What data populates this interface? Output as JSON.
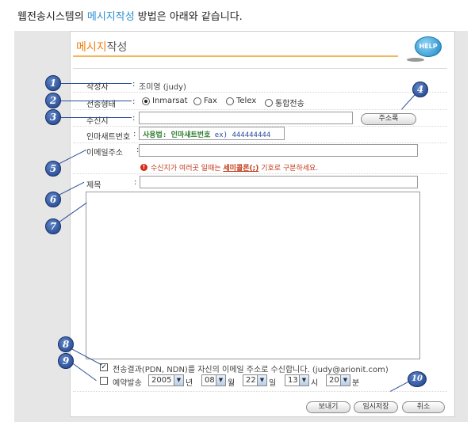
{
  "heading": {
    "prefix": "웹전송시스템의 ",
    "highlight": "메시지작성",
    "suffix": " 방법은 아래와 같습니다."
  },
  "window": {
    "title_accent": "메시지",
    "title_rest": "작성",
    "help_label": "HELP"
  },
  "form": {
    "author_label": "작성자",
    "author_value": "조미영 (judy)",
    "send_type_label": "전송형태",
    "send_types": [
      {
        "label": "Inmarsat",
        "selected": true
      },
      {
        "label": "Fax",
        "selected": false
      },
      {
        "label": "Telex",
        "selected": false
      },
      {
        "label": "통합전송",
        "selected": false
      }
    ],
    "recipient_label": "수신지",
    "recipient_value": "",
    "address_book_label": "주소록",
    "inmarsat_label": "인마새트번호",
    "inmarsat_usage": "사용법: 인마새트번호",
    "inmarsat_example": "ex) 444444444",
    "email_label": "이메일주소",
    "email_value": "",
    "warning": {
      "icon": "!",
      "before": "수신지가 여러곳 일때는 ",
      "emph": "세미콜론(;)",
      "after": " 기호로 구분하세요."
    },
    "subject_label": "제목",
    "subject_value": "",
    "body_value": "",
    "receive_result": {
      "checked": true,
      "label": "전송결과(PDN, NDN)를 자신의 이메일 주소로 수신합니다. (judy@arionit.com)"
    },
    "reserve": {
      "checked": false,
      "label": "예약발송",
      "year": "2005",
      "year_unit": "년",
      "month": "08",
      "month_unit": "월",
      "day": "22",
      "day_unit": "일",
      "hour": "13",
      "hour_unit": "시",
      "minute": "20",
      "minute_unit": "분"
    },
    "buttons": {
      "send": "보내기",
      "save_draft": "임시저장",
      "cancel": "취소"
    }
  },
  "callouts": [
    "1",
    "2",
    "3",
    "4",
    "5",
    "6",
    "7",
    "8",
    "9",
    "10"
  ],
  "colors": {
    "accent": "#f07f12",
    "highlight": "#2b8fd0",
    "badge": "#1e3f86",
    "warning": "#c03a1a"
  }
}
